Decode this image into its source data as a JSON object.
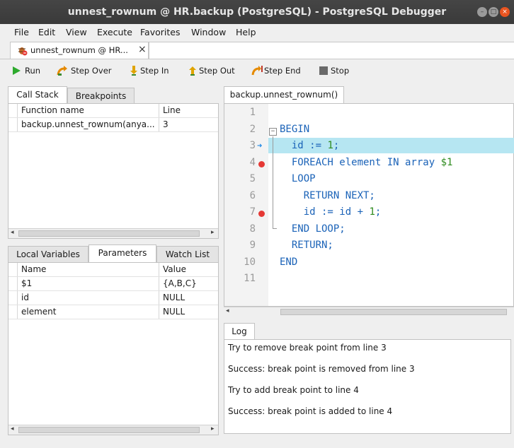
{
  "window": {
    "title": "unnest_rownum @ HR.backup (PostgreSQL) - PostgreSQL Debugger"
  },
  "menu": {
    "file": "File",
    "edit": "Edit",
    "view": "View",
    "execute": "Execute",
    "favorites": "Favorites",
    "window": "Window",
    "help": "Help"
  },
  "doc_tab": {
    "label": "unnest_rownum @ HR...",
    "close": "×"
  },
  "toolbar": {
    "run": "Run",
    "step_over": "Step Over",
    "step_in": "Step In",
    "step_out": "Step Out",
    "step_end": "Step End",
    "stop": "Stop"
  },
  "top_panel": {
    "tabs": [
      "Call Stack",
      "Breakpoints"
    ],
    "columns": [
      "Function name",
      "Line"
    ],
    "rows": [
      {
        "function": "backup.unnest_rownum(anya...",
        "line": "3"
      }
    ]
  },
  "bottom_panel": {
    "tabs": [
      "Local Variables",
      "Parameters",
      "Watch List"
    ],
    "columns": [
      "Name",
      "Value"
    ],
    "rows": [
      {
        "name": "$1",
        "value": "{A,B,C}"
      },
      {
        "name": "id",
        "value": "NULL"
      },
      {
        "name": "element",
        "value": "NULL"
      }
    ]
  },
  "editor": {
    "tab": "backup.unnest_rownum()",
    "line_numbers": [
      "1",
      "2",
      "3",
      "4",
      "5",
      "6",
      "7",
      "8",
      "9",
      "10",
      "11"
    ],
    "current_line": 3,
    "breakpoint_lines": [
      4,
      7
    ],
    "lines": {
      "l2": "BEGIN",
      "l3a": "  id := ",
      "l3b": "1",
      "l3c": ";",
      "l4a": "  FOREACH element IN array ",
      "l4b": "$1",
      "l5": "  LOOP",
      "l6": "    RETURN NEXT;",
      "l7a": "    id := id + ",
      "l7b": "1",
      "l7c": ";",
      "l8": "  END LOOP;",
      "l9": "  RETURN;",
      "l10": "END"
    }
  },
  "log": {
    "tab": "Log",
    "entries": [
      "Try to remove break point from line 3",
      "Success: break point is removed from line 3",
      "Try to add break point to line 4",
      "Success: break point is added to line 4"
    ]
  },
  "colors": {
    "highlight": "#b6e6f2",
    "breakpoint": "#e53935",
    "keyword": "#1b63b8",
    "number": "#2e8b1e"
  }
}
